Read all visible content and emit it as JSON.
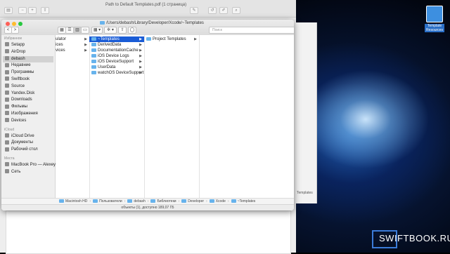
{
  "preview": {
    "title": "Path to Default Templates.pdf (1 страница)"
  },
  "desktop": {
    "icon_label_1": "Template",
    "icon_label_2": "Resources",
    "back_window_text": "Templates"
  },
  "watermark": {
    "text": "SWIFTBOOK.RU"
  },
  "finder": {
    "title": "/Users/debash/Library/Developer/Xcode/~Templates",
    "search_placeholder": "Поиск",
    "toolbar": {
      "back": "<",
      "forward": ">",
      "view_icons": "▦",
      "view_list": "☰",
      "view_columns": "▥",
      "view_gallery": "▭",
      "arrange": "▦ ▾",
      "action": "✲ ▾",
      "share": "⇧",
      "tag": "◯"
    },
    "sidebar": {
      "sections": [
        {
          "header": "Избранное",
          "items": [
            {
              "label": "Setapp",
              "icon": "setapp-icon"
            },
            {
              "label": "AirDrop",
              "icon": "airdrop-icon"
            },
            {
              "label": "debash",
              "icon": "home-icon",
              "selected": true
            },
            {
              "label": "Недавние",
              "icon": "clock-icon"
            },
            {
              "label": "Программы",
              "icon": "apps-icon"
            },
            {
              "label": "Swiftbook",
              "icon": "folder-icon"
            },
            {
              "label": "Source",
              "icon": "folder-icon"
            },
            {
              "label": "Yandex.Disk",
              "icon": "cloud-icon"
            },
            {
              "label": "Downloads",
              "icon": "download-icon"
            },
            {
              "label": "Фильмы",
              "icon": "film-icon"
            },
            {
              "label": "Изображения",
              "icon": "photo-icon"
            },
            {
              "label": "Devices",
              "icon": "folder-icon"
            }
          ]
        },
        {
          "header": "iCloud",
          "items": [
            {
              "label": "iCloud Drive",
              "icon": "icloud-icon"
            },
            {
              "label": "Документы",
              "icon": "document-icon"
            },
            {
              "label": "Рабочий стол",
              "icon": "desktop-icon"
            }
          ]
        },
        {
          "header": "Места",
          "items": [
            {
              "label": "MacBook Pro — Alexey",
              "icon": "laptop-icon"
            },
            {
              "label": "Сеть",
              "icon": "network-icon"
            }
          ]
        }
      ]
    },
    "columns": [
      {
        "items": [
          {
            "label": "ulator",
            "chevron": true,
            "partial": true
          },
          {
            "label": "ices",
            "chevron": true,
            "partial": true
          },
          {
            "label": "vices",
            "chevron": true,
            "partial": true
          }
        ]
      },
      {
        "items": [
          {
            "label": "~Templates",
            "chevron": true,
            "selected": true
          },
          {
            "label": "DerivedData",
            "chevron": true
          },
          {
            "label": "DocumentationCache",
            "chevron": true
          },
          {
            "label": "iOS Device Logs",
            "chevron": true
          },
          {
            "label": "iOS DeviceSupport",
            "chevron": true
          },
          {
            "label": "UserData",
            "chevron": true
          },
          {
            "label": "watchOS DeviceSupport",
            "chevron": true
          }
        ]
      },
      {
        "items": [
          {
            "label": "Project Templates",
            "chevron": true
          }
        ]
      },
      {
        "items": []
      }
    ],
    "pathbar": [
      "Macintosh HD",
      "Пользователи",
      "debash",
      "Библиотеки",
      "Developer",
      "Xcode",
      "~Templates"
    ],
    "status": "объекты (1), доступно 189,07 ГБ"
  }
}
